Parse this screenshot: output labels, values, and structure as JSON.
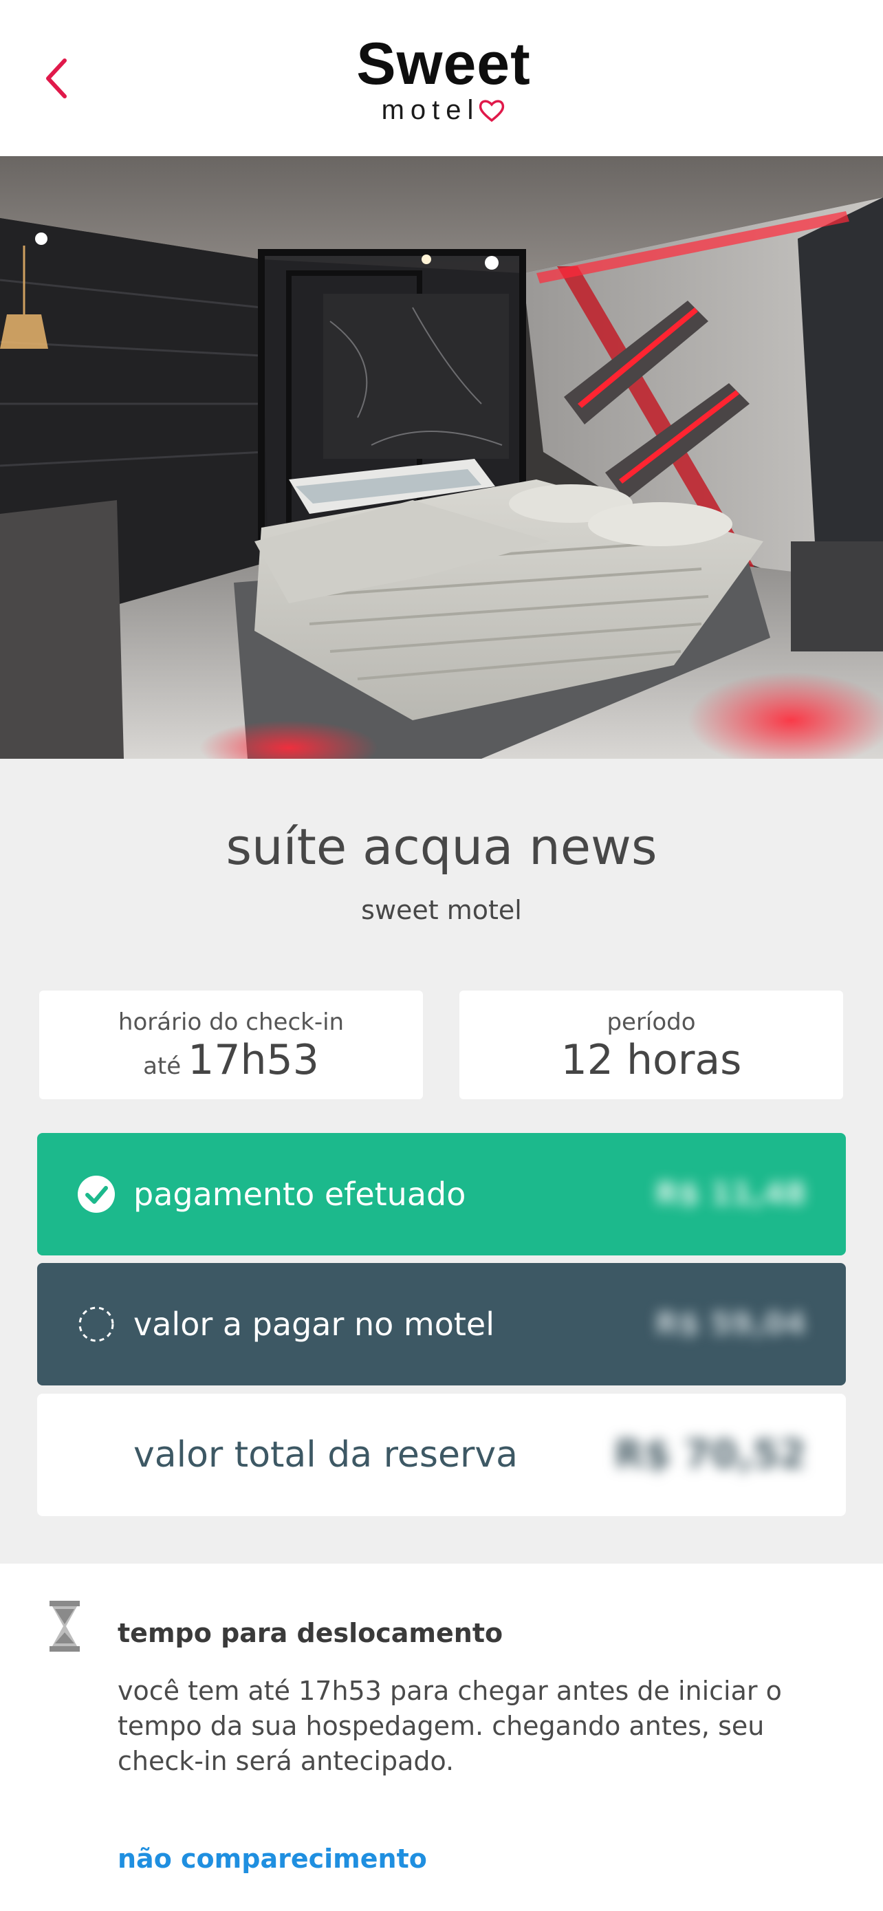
{
  "header": {
    "back_icon": "chevron-left-icon",
    "logo_main": "Sweet",
    "logo_sub": "motel",
    "accent_color": "#e0194a"
  },
  "hero": {
    "image_description_icon": "suite-photo"
  },
  "suite": {
    "name": "suíte acqua news",
    "motel": "sweet motel"
  },
  "checkin": {
    "label": "horário do check-in",
    "prefix": "até",
    "time": "17h53"
  },
  "period": {
    "label": "período",
    "value": "12 horas"
  },
  "payments": {
    "paid": {
      "label": "pagamento efetuado",
      "amount": "R$ 11,48",
      "icon": "check-circle-icon",
      "color": "#1cb98c"
    },
    "due": {
      "label": "valor a pagar no motel",
      "amount": "R$ 59,04",
      "icon": "dashed-circle-icon",
      "color": "#3d5864"
    },
    "total": {
      "label": "valor total da reserva",
      "amount": "R$ 70,52"
    }
  },
  "travel": {
    "icon": "hourglass-icon",
    "title": "tempo para deslocamento",
    "text": "você tem até 17h53 para chegar antes de iniciar o tempo da sua hospedagem. chegando antes, seu check-in será antecipado.",
    "link": "não comparecimento",
    "link_color": "#1f8fe0"
  }
}
